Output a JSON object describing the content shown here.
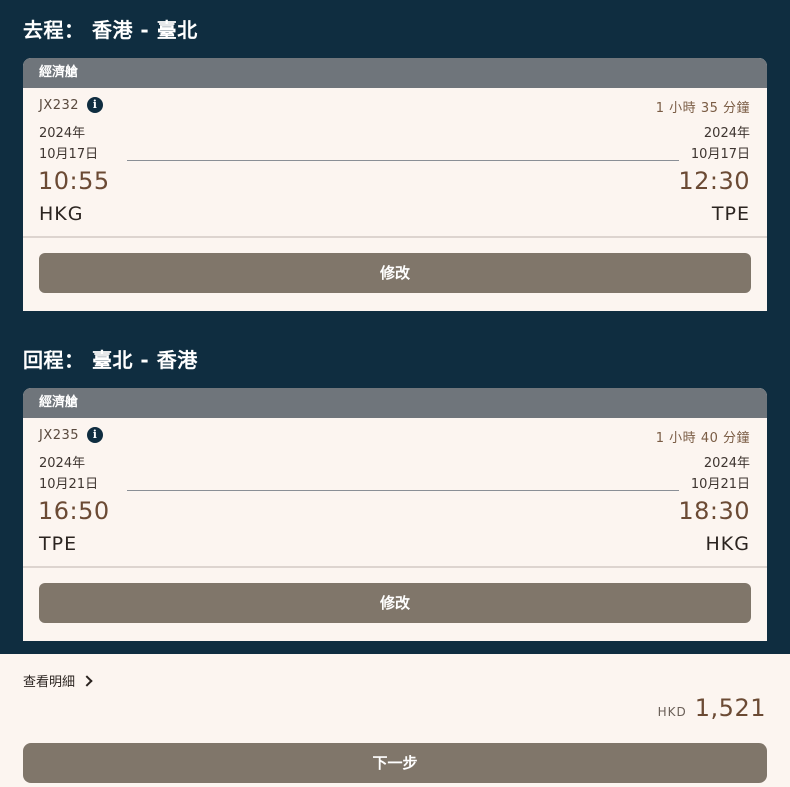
{
  "outbound": {
    "title": "去程： 香港 - 臺北",
    "cabin": "經濟艙",
    "flight_no": "JX232",
    "duration": "1 小時 35 分鐘",
    "depart": {
      "year": "2024年",
      "date": "10月17日",
      "time": "10:55",
      "airport": "HKG"
    },
    "arrive": {
      "year": "2024年",
      "date": "10月17日",
      "time": "12:30",
      "airport": "TPE"
    },
    "modify_label": "修改"
  },
  "inbound": {
    "title": "回程： 臺北 - 香港",
    "cabin": "經濟艙",
    "flight_no": "JX235",
    "duration": "1 小時 40 分鐘",
    "depart": {
      "year": "2024年",
      "date": "10月21日",
      "time": "16:50",
      "airport": "TPE"
    },
    "arrive": {
      "year": "2024年",
      "date": "10月21日",
      "time": "18:30",
      "airport": "HKG"
    },
    "modify_label": "修改"
  },
  "summary": {
    "details_label": "查看明細",
    "currency": "HKD",
    "amount": "1,521",
    "next_label": "下一步"
  },
  "icons": {
    "info": "info-icon",
    "chevron": "chevron-right-icon"
  },
  "colors": {
    "background": "#0f2d40",
    "card": "#fcf5f0",
    "cabin_header": "#6f757b",
    "button": "#80766a",
    "accent_text": "#6b4a34"
  }
}
